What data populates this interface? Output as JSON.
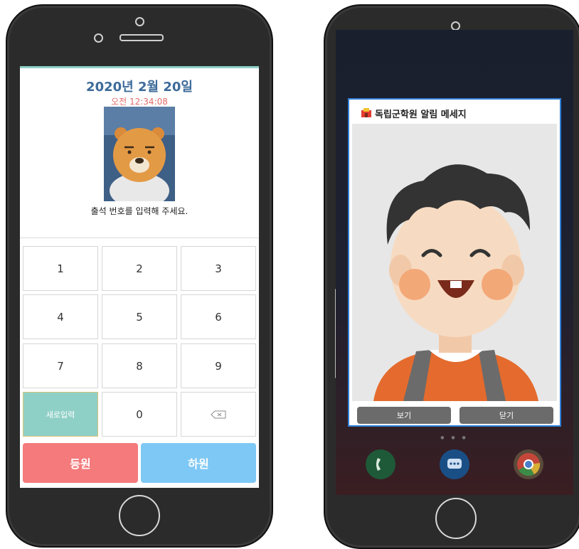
{
  "attendance": {
    "date": "2020년 2월 20일",
    "time": "오전 12:34:08",
    "prompt": "출석 번호를 입력해 주세요.",
    "keys": [
      "1",
      "2",
      "3",
      "4",
      "5",
      "6",
      "7",
      "8",
      "9"
    ],
    "reset_label": "새로입력",
    "zero": "0",
    "backspace_icon": "backspace-icon",
    "checkin_label": "등원",
    "checkout_label": "하원",
    "colors": {
      "accent": "#8fd0c6",
      "checkin": "#f47a7c",
      "checkout": "#7ec8f5",
      "date": "#3d6b9a",
      "time": "#e36b6b"
    }
  },
  "notification": {
    "title": "독립군학원 알림 메세지",
    "view_label": "보기",
    "close_label": "닫기",
    "app_icons": [
      "phone-icon",
      "messages-icon",
      "chrome-icon"
    ],
    "colors": {
      "border": "#2f7fd6"
    }
  }
}
